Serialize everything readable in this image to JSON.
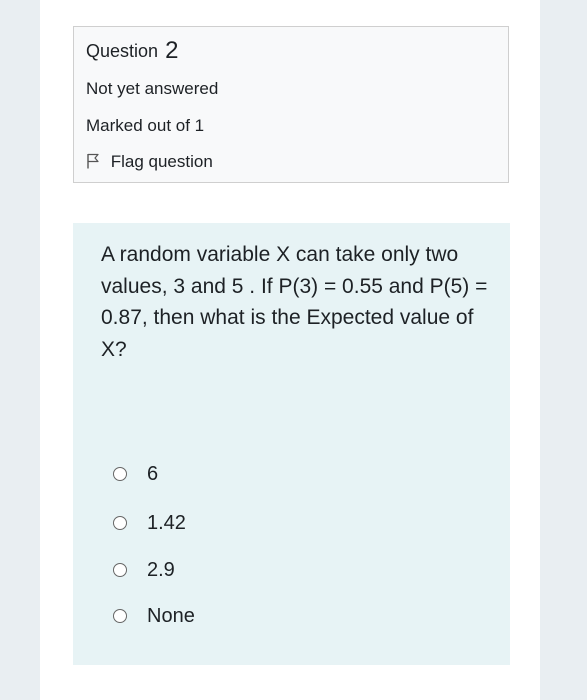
{
  "question_info": {
    "label": "Question",
    "number": "2",
    "status": "Not yet answered",
    "marks": "Marked out of 1",
    "flag_label": "Flag question"
  },
  "question": {
    "text": "A random variable X can take only two values, 3 and 5 . If P(3) = 0.55 and P(5) = 0.87, then what is the Expected value of X?",
    "options": [
      {
        "label": "6",
        "selected": false
      },
      {
        "label": "1.42",
        "selected": false
      },
      {
        "label": "2.9",
        "selected": false
      },
      {
        "label": "None",
        "selected": false
      }
    ]
  },
  "icons": {
    "flag": "flag-outline-icon",
    "option_radio": "radio-button-icon"
  },
  "colors": {
    "page_background": "#e9eef2",
    "info_box_background": "#f8f9fa",
    "question_box_background": "#e7f3f5",
    "text": "#1d2125"
  }
}
